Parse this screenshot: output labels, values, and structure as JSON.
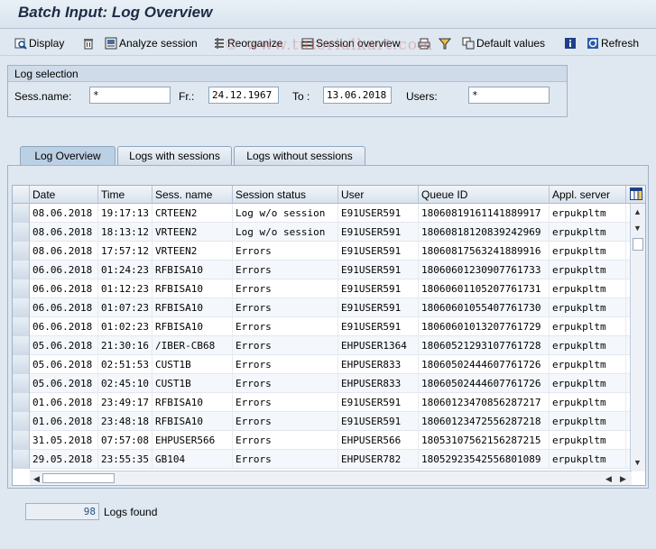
{
  "window": {
    "title": "Batch Input: Log Overview"
  },
  "toolbar": {
    "display": "Display",
    "analyze_session": "Analyze session",
    "reorganize": "Reorganize",
    "session_overview": "Session overview",
    "default_values": "Default values",
    "refresh": "Refresh"
  },
  "watermark": "© www.tutorialkart.com",
  "log_selection": {
    "title": "Log selection",
    "sess_name_label": "Sess.name:",
    "sess_name_value": "*",
    "from_label": "Fr.:",
    "from_value": "24.12.1967",
    "to_label": "To :",
    "to_value": "13.06.2018",
    "users_label": "Users:",
    "users_value": "*"
  },
  "tabs": [
    "Log Overview",
    "Logs with sessions",
    "Logs without sessions"
  ],
  "table": {
    "columns": [
      "Date",
      "Time",
      "Sess. name",
      "Session status",
      "User",
      "Queue ID",
      "Appl. server"
    ],
    "rows": [
      [
        "08.06.2018",
        "19:17:13",
        "CRTEEN2",
        "Log w/o session",
        "E91USER591",
        "18060819161141889917",
        "erpukpltm"
      ],
      [
        "08.06.2018",
        "18:13:12",
        "VRTEEN2",
        "Log w/o session",
        "E91USER591",
        "18060818120839242969",
        "erpukpltm"
      ],
      [
        "08.06.2018",
        "17:57:12",
        "VRTEEN2",
        "Errors",
        "E91USER591",
        "18060817563241889916",
        "erpukpltm"
      ],
      [
        "06.06.2018",
        "01:24:23",
        "RFBISA10",
        "Errors",
        "E91USER591",
        "18060601230907761733",
        "erpukpltm"
      ],
      [
        "06.06.2018",
        "01:12:23",
        "RFBISA10",
        "Errors",
        "E91USER591",
        "18060601105207761731",
        "erpukpltm"
      ],
      [
        "06.06.2018",
        "01:07:23",
        "RFBISA10",
        "Errors",
        "E91USER591",
        "18060601055407761730",
        "erpukpltm"
      ],
      [
        "06.06.2018",
        "01:02:23",
        "RFBISA10",
        "Errors",
        "E91USER591",
        "18060601013207761729",
        "erpukpltm"
      ],
      [
        "05.06.2018",
        "21:30:16",
        "/IBER-CB68",
        "Errors",
        "EHPUSER1364",
        "18060521293107761728",
        "erpukpltm"
      ],
      [
        "05.06.2018",
        "02:51:53",
        "CUST1B",
        "Errors",
        "EHPUSER833",
        "18060502444607761726",
        "erpukpltm"
      ],
      [
        "05.06.2018",
        "02:45:10",
        "CUST1B",
        "Errors",
        "EHPUSER833",
        "18060502444607761726",
        "erpukpltm"
      ],
      [
        "01.06.2018",
        "23:49:17",
        "RFBISA10",
        "Errors",
        "E91USER591",
        "18060123470856287217",
        "erpukpltm"
      ],
      [
        "01.06.2018",
        "23:48:18",
        "RFBISA10",
        "Errors",
        "E91USER591",
        "18060123472556287218",
        "erpukpltm"
      ],
      [
        "31.05.2018",
        "07:57:08",
        "EHPUSER566",
        "Errors",
        "EHPUSER566",
        "18053107562156287215",
        "erpukpltm"
      ],
      [
        "29.05.2018",
        "23:55:35",
        "GB104",
        "Errors",
        "EHPUSER782",
        "18052923542556801089",
        "erpukpltm"
      ]
    ]
  },
  "status": {
    "count": "98",
    "count_label": "Logs found"
  },
  "colors": {
    "background": "#dfe8f1",
    "accent": "#1d2c44"
  }
}
